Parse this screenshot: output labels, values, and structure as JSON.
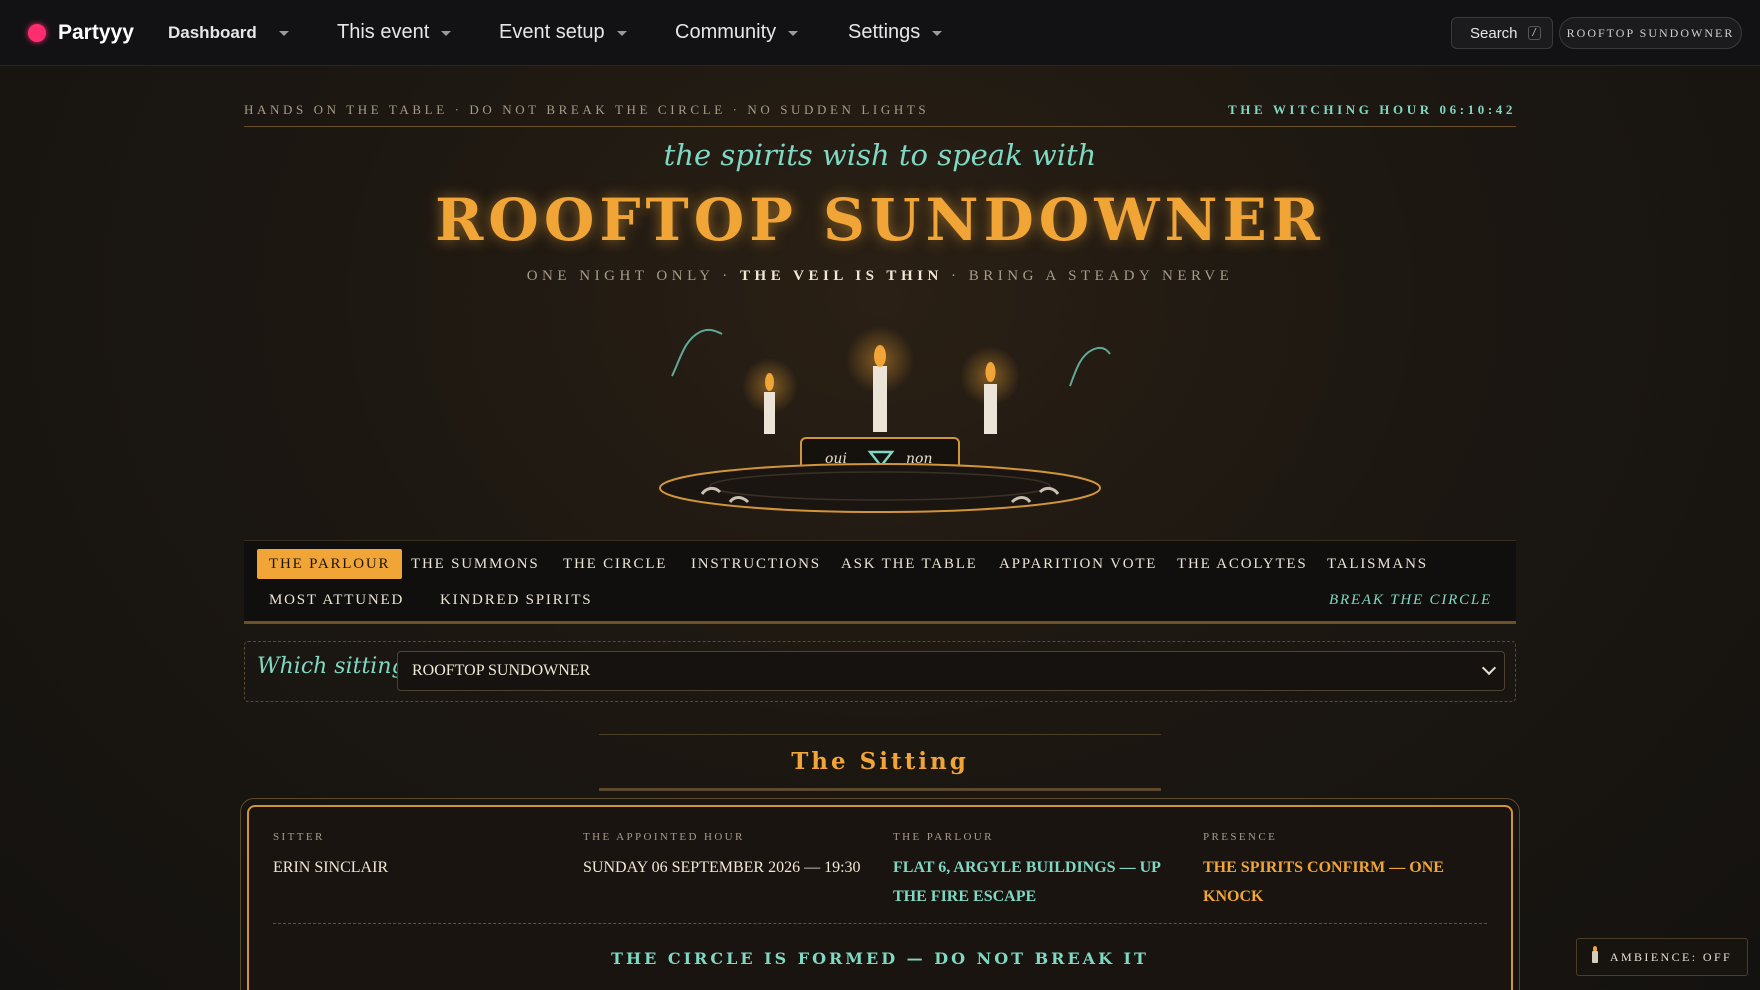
{
  "topnav": {
    "brand": "Partyyy",
    "dashboard": "Dashboard",
    "items": [
      "This event",
      "Event setup",
      "Community",
      "Settings"
    ],
    "search_label": "Search",
    "search_shortcut": "/",
    "event_chip": "ROOFTOP SUNDOWNER"
  },
  "header": {
    "rules": "HANDS ON THE TABLE · DO NOT BREAK THE CIRCLE · NO SUDDEN LIGHTS",
    "clock": "THE WITCHING HOUR 06:10:42",
    "script_line": "the spirits wish to speak with",
    "title": "ROOFTOP SUNDOWNER",
    "tagline_left": "ONE NIGHT ONLY · ",
    "tagline_bold": "THE VEIL IS THIN",
    "tagline_right": " · BRING A STEADY NERVE"
  },
  "ouija": {
    "yes": "oui",
    "no": "non"
  },
  "tabs": {
    "items": [
      "THE PARLOUR",
      "THE SUMMONS",
      "THE CIRCLE",
      "INSTRUCTIONS",
      "ASK THE TABLE",
      "APPARITION VOTE",
      "THE ACOLYTES",
      "TALISMANS",
      "MOST ATTUNED",
      "KINDRED SPIRITS"
    ],
    "active": "THE PARLOUR",
    "break": "BREAK THE CIRCLE"
  },
  "selector": {
    "label": "Which sitting?",
    "value": "ROOFTOP SUNDOWNER"
  },
  "sitting": {
    "heading": "The Sitting",
    "sitter_label": "SITTER",
    "sitter": "ERIN SINCLAIR",
    "hour_label": "THE APPOINTED HOUR",
    "hour": "SUNDAY 06 SEPTEMBER 2026 — 19:30",
    "parlour_label": "THE PARLOUR",
    "parlour": "FLAT 6, ARGYLE BUILDINGS — UP THE FIRE ESCAPE",
    "presence_label": "PRESENCE",
    "presence": "THE SPIRITS CONFIRM — ONE KNOCK",
    "motto": "THE CIRCLE IS FORMED — DO NOT BREAK IT"
  },
  "ambience": "AMBIENCE: OFF",
  "colors": {
    "accent": "#f0a536",
    "teal": "#7fd8c4",
    "brand": "#ff2d6f"
  }
}
